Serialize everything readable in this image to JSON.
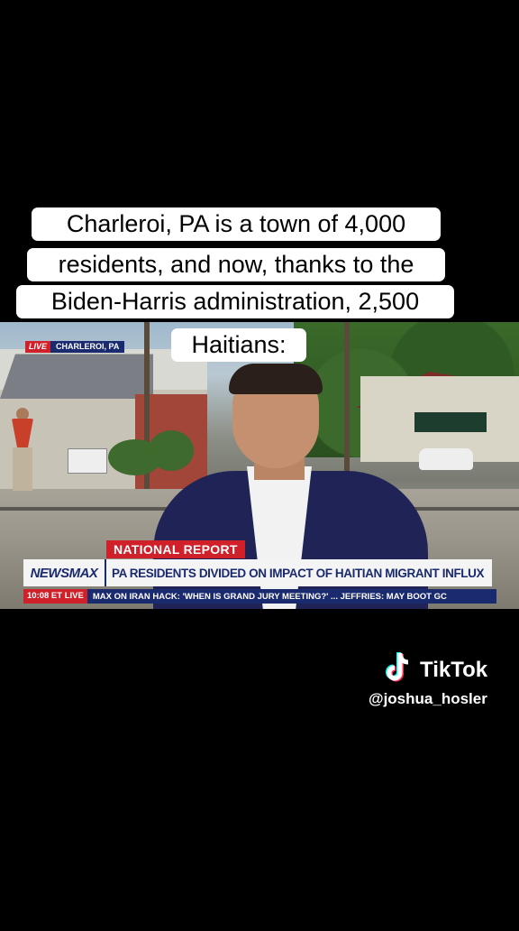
{
  "caption": {
    "lines": [
      "Charleroi, PA is a town of 4,000",
      "residents, and now, thanks to the",
      "Biden-Harris administration, 2,500",
      "Haitians:"
    ]
  },
  "video": {
    "live_bug": {
      "live": "LIVE",
      "location": "CHARLEROI, PA"
    },
    "segment_label": "NATIONAL REPORT",
    "network": "NEWSMAX",
    "headline": "PA RESIDENTS DIVIDED ON IMPACT OF HAITIAN MIGRANT INFLUX",
    "ticker_time": "10:08 ET  LIVE",
    "ticker_text": "MAX ON IRAN HACK: 'WHEN IS GRAND JURY MEETING?' ...     JEFFRIES: MAY BOOT GC"
  },
  "watermark": {
    "brand": "TikTok",
    "username": "@joshua_hosler"
  },
  "colors": {
    "newsmax_red": "#d0202a",
    "newsmax_navy": "#1a2a6e"
  }
}
